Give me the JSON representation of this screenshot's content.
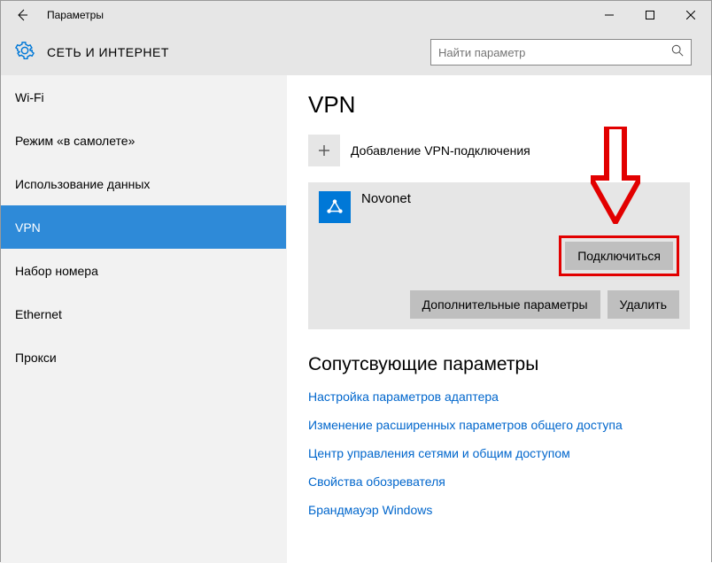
{
  "window": {
    "title": "Параметры"
  },
  "header": {
    "title": "СЕТЬ И ИНТЕРНЕТ",
    "search_placeholder": "Найти параметр"
  },
  "sidebar": {
    "items": [
      {
        "label": "Wi-Fi"
      },
      {
        "label": "Режим «в самолете»"
      },
      {
        "label": "Использование данных"
      },
      {
        "label": "VPN"
      },
      {
        "label": "Набор номера"
      },
      {
        "label": "Ethernet"
      },
      {
        "label": "Прокси"
      }
    ],
    "selected_index": 3
  },
  "main": {
    "heading": "VPN",
    "add_label": "Добавление VPN-подключения",
    "connection": {
      "name": "Novonet",
      "connect_label": "Подключиться",
      "advanced_label": "Дополнительные параметры",
      "delete_label": "Удалить"
    },
    "related": {
      "heading": "Сопутсвующие параметры",
      "links": [
        "Настройка параметров адаптера",
        "Изменение расширенных параметров общего доступа",
        "Центр управления сетями и общим доступом",
        "Свойства обозревателя",
        "Брандмауэр Windows"
      ]
    }
  }
}
